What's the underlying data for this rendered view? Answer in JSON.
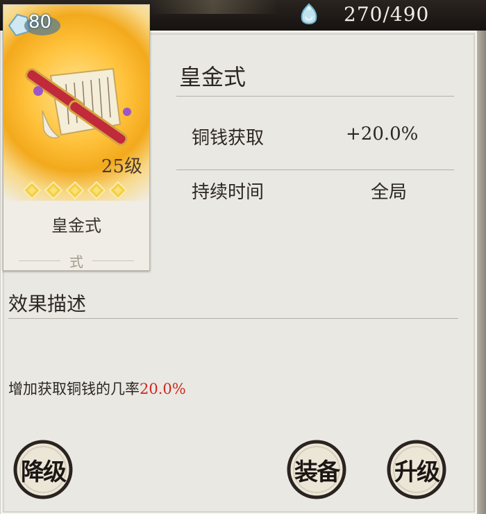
{
  "topbar": {
    "resource_icon": "soul-jade-icon",
    "resource_count": "270/490"
  },
  "card": {
    "level": "80",
    "level_icon": "crystal-icon",
    "art_icon": "golden-scroll-icon",
    "grade": "25级",
    "stars": 5,
    "name": "皇金式",
    "type": "式"
  },
  "details": {
    "title": "皇金式",
    "stats": [
      {
        "label": "铜钱获取",
        "value": "+20.0%"
      },
      {
        "label": "持续时间",
        "value": "全局"
      }
    ]
  },
  "effect": {
    "section_title": "效果描述",
    "text": "增加获取铜钱的几率",
    "highlight": "20.0%"
  },
  "buttons": {
    "downgrade": "降级",
    "equip": "装备",
    "upgrade": "升级"
  },
  "colors": {
    "highlight": "#d0261c",
    "panel": "#e9e8e3",
    "star": "#f5cf45"
  }
}
